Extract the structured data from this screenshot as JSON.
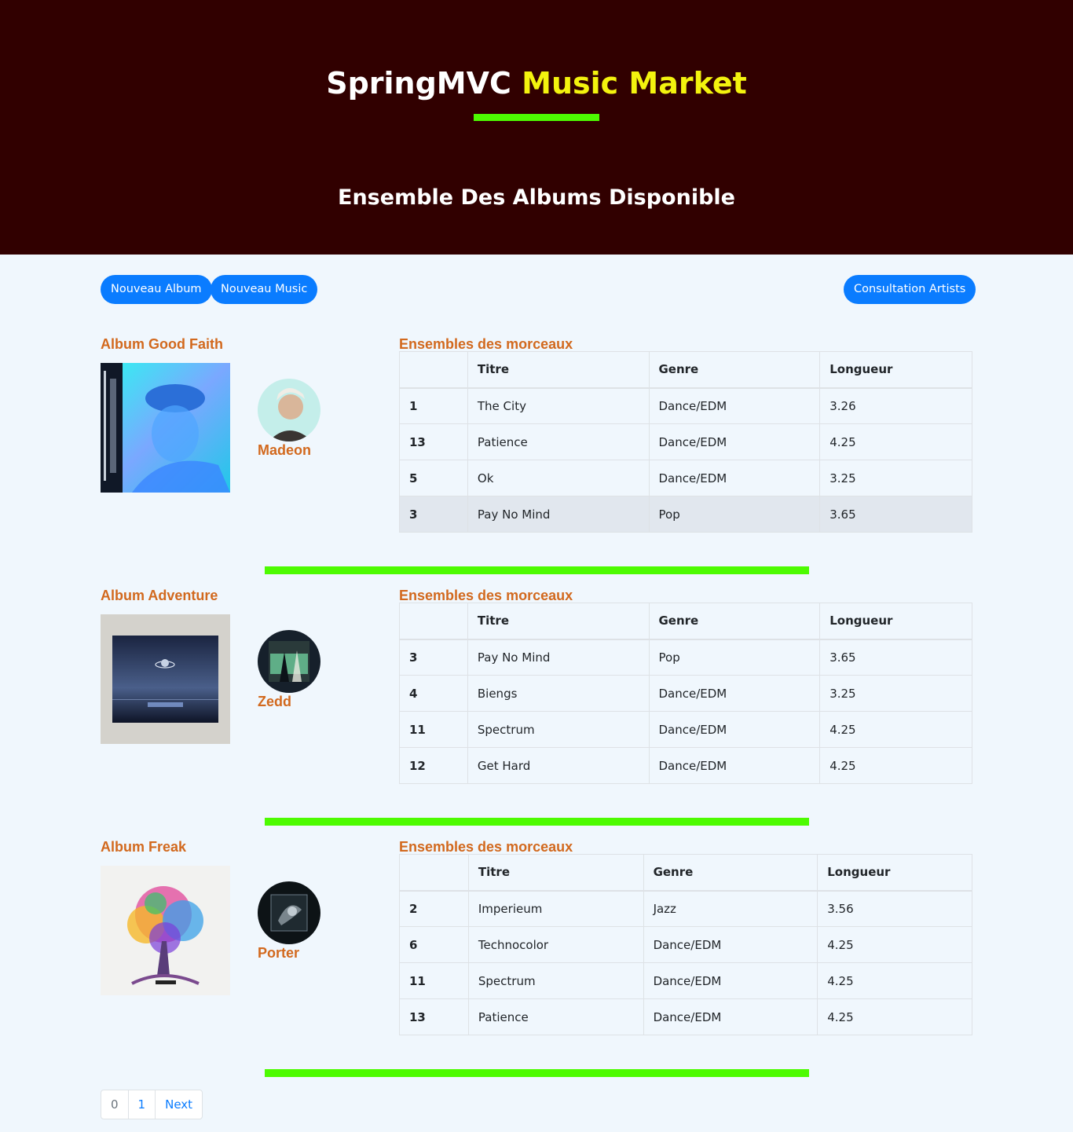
{
  "header": {
    "title_part1": "SpringMVC",
    "title_part2": "Music Market",
    "subtitle": "Ensemble Des Albums Disponible"
  },
  "toolbar": {
    "new_album": "Nouveau Album",
    "new_music": "Nouveau Music",
    "artists": "Consultation Artists"
  },
  "albums": [
    {
      "title": "Album Good Faith",
      "tracks_heading": "Ensembles des morceaux",
      "artist": "Madeon",
      "columns": [
        "",
        "Titre",
        "Genre",
        "Longueur"
      ],
      "rows": [
        [
          "1",
          "The City",
          "Dance/EDM",
          "3.26"
        ],
        [
          "13",
          "Patience",
          "Dance/EDM",
          "4.25"
        ],
        [
          "5",
          "Ok",
          "Dance/EDM",
          "3.25"
        ],
        [
          "3",
          "Pay No Mind",
          "Pop",
          "3.65"
        ]
      ]
    },
    {
      "title": "Album Adventure",
      "tracks_heading": "Ensembles des morceaux",
      "artist": "Zedd",
      "columns": [
        "",
        "Titre",
        "Genre",
        "Longueur"
      ],
      "rows": [
        [
          "3",
          "Pay No Mind",
          "Pop",
          "3.65"
        ],
        [
          "4",
          "Biengs",
          "Dance/EDM",
          "3.25"
        ],
        [
          "11",
          "Spectrum",
          "Dance/EDM",
          "4.25"
        ],
        [
          "12",
          "Get Hard",
          "Dance/EDM",
          "4.25"
        ]
      ]
    },
    {
      "title": "Album Freak",
      "tracks_heading": "Ensembles des morceaux",
      "artist": "Porter",
      "columns": [
        "",
        "Titre",
        "Genre",
        "Longueur"
      ],
      "rows": [
        [
          "2",
          "Imperieum",
          "Jazz",
          "3.56"
        ],
        [
          "6",
          "Technocolor",
          "Dance/EDM",
          "4.25"
        ],
        [
          "11",
          "Spectrum",
          "Dance/EDM",
          "4.25"
        ],
        [
          "13",
          "Patience",
          "Dance/EDM",
          "4.25"
        ]
      ]
    }
  ],
  "pagination": {
    "pages": [
      "0",
      "1"
    ],
    "next": "Next"
  },
  "colors": {
    "header_bg": "#310000",
    "accent_yellow": "#f3f30e",
    "divider_green": "#4dfb01",
    "button_blue": "#0a7cff",
    "label_orange": "#d2691e"
  }
}
